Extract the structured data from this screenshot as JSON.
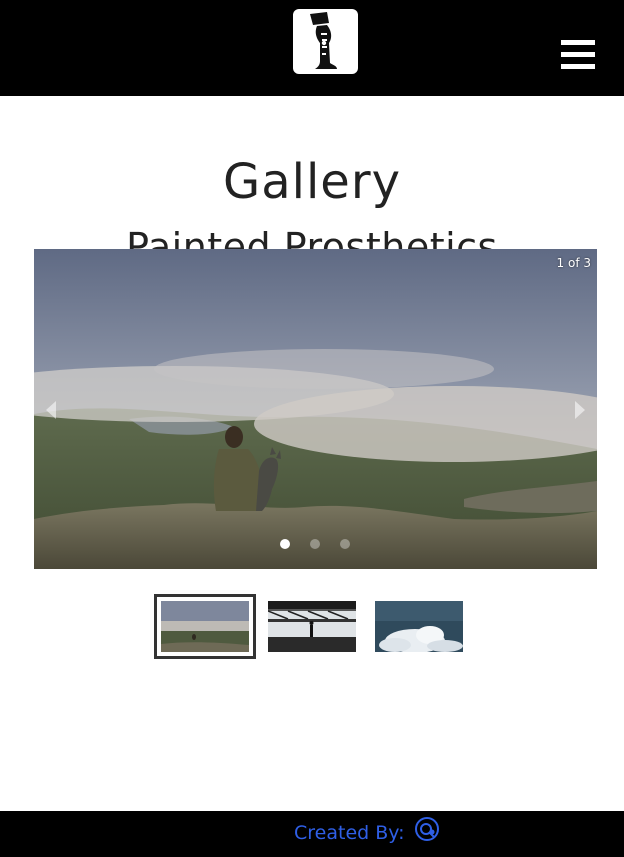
{
  "header": {
    "logo_icon": "prosthetic-leg-logo",
    "menu_icon": "hamburger-menu-icon"
  },
  "page": {
    "title": "Gallery",
    "subtitle": "Painted Prosthetics"
  },
  "slideshow": {
    "counter": "1 of 3",
    "current_slide": 1,
    "total_slides": 3,
    "prev_icon": "chevron-left-icon",
    "next_icon": "chevron-right-icon"
  },
  "thumbnails": [
    {
      "name": "mountain-summit-thumbnail",
      "selected": true
    },
    {
      "name": "person-under-bridge-thumbnail",
      "selected": false
    },
    {
      "name": "clouds-sky-thumbnail",
      "selected": false
    }
  ],
  "footer": {
    "credit_label": "Created By:",
    "credit_icon": "creator-logo-icon",
    "credit_color": "#2f5fe6"
  }
}
